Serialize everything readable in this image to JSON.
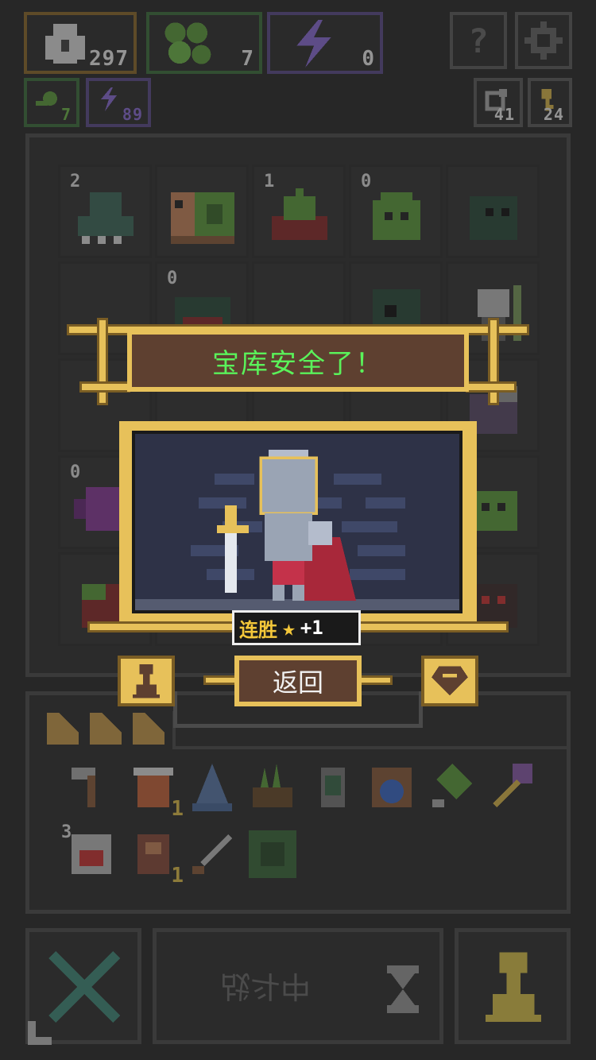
{
  "top_resources": [
    {
      "name": "coins",
      "value": "297"
    },
    {
      "name": "food",
      "value": "7"
    },
    {
      "name": "energy",
      "value": "0"
    }
  ],
  "top_buttons": {
    "help": "help-button",
    "settings": "settings-button"
  },
  "sub_resources": [
    {
      "name": "green",
      "value": "7"
    },
    {
      "name": "energy-small",
      "value": "89"
    },
    {
      "name": "refresh",
      "value": "41"
    },
    {
      "name": "key",
      "value": "24"
    }
  ],
  "grid_counts": [
    "2",
    "1",
    "0",
    "0",
    "0"
  ],
  "dialog": {
    "banner": "宝库安全了！",
    "streak_label": "连胜",
    "streak_value": "+1",
    "back": "返回"
  },
  "inventory_counts": {
    "bundle": "1",
    "scroll": "1",
    "card": "3"
  },
  "bottom": {
    "battle_label": "战斗中"
  },
  "colors": {
    "gold": "#e7c15a",
    "banner_text": "#5af25a",
    "panel_bg": "#2f2f2f"
  }
}
